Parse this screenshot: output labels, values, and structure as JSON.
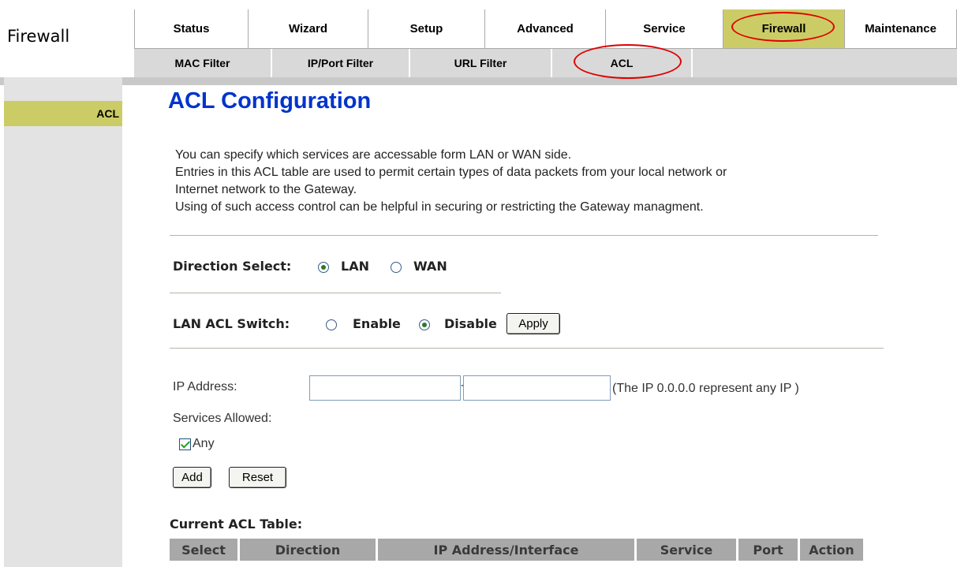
{
  "section_title": "Firewall",
  "nav": {
    "top_tabs": [
      {
        "label": "Status"
      },
      {
        "label": "Wizard"
      },
      {
        "label": "Setup"
      },
      {
        "label": "Advanced"
      },
      {
        "label": "Service"
      },
      {
        "label": "Firewall",
        "active": true
      },
      {
        "label": "Maintenance"
      }
    ],
    "sub_tabs": [
      {
        "label": "MAC Filter"
      },
      {
        "label": "IP/Port Filter"
      },
      {
        "label": "URL Filter"
      },
      {
        "label": "ACL",
        "active": true
      }
    ]
  },
  "sidebar": {
    "items": [
      {
        "label": "ACL",
        "active": true
      }
    ]
  },
  "page": {
    "title": "ACL Configuration",
    "description": [
      "You can specify which services are accessable form LAN or WAN side.",
      "Entries in this ACL table are used to permit certain types of data packets from your local network or",
      "Internet network to the Gateway.",
      "Using of such access control can be helpful in securing or restricting the Gateway managment."
    ]
  },
  "direction": {
    "label": "Direction Select:",
    "options": [
      {
        "label": "LAN",
        "checked": true
      },
      {
        "label": "WAN",
        "checked": false
      }
    ]
  },
  "switch": {
    "label": "LAN ACL Switch:",
    "options": [
      {
        "label": "Enable",
        "checked": false
      },
      {
        "label": "Disable",
        "checked": true
      }
    ],
    "apply_label": "Apply"
  },
  "ip": {
    "label": "IP Address:",
    "start_value": "",
    "end_value": "",
    "hint": "(The IP 0.0.0.0 represent any IP )"
  },
  "services": {
    "label": "Services Allowed:",
    "any_label": "Any",
    "any_checked": true
  },
  "buttons": {
    "add": "Add",
    "reset": "Reset"
  },
  "table": {
    "title": "Current ACL Table:",
    "columns": [
      "Select",
      "Direction",
      "IP Address/Interface",
      "Service",
      "Port",
      "Action"
    ]
  },
  "colors": {
    "active_tab": "#cccc66",
    "title_blue": "#0033cc",
    "highlight_ellipse": "#e00000"
  }
}
